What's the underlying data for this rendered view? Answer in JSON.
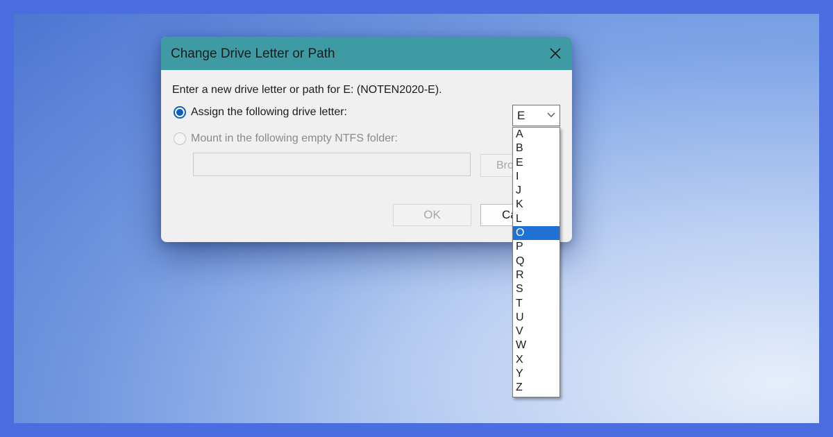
{
  "dialog": {
    "title": "Change Drive Letter or Path",
    "prompt": "Enter a new drive letter or path for E: (NOTEN2020-E).",
    "assign_label": "Assign the following drive letter:",
    "mount_label": "Mount in the following empty NTFS folder:",
    "folder_value": "",
    "browse_label": "Bro",
    "ok_label": "OK",
    "cancel_label": "Ca",
    "titlebar_color": "#3f9ba3"
  },
  "drive_select": {
    "value": "E",
    "options": [
      "A",
      "B",
      "E",
      "I",
      "J",
      "K",
      "L",
      "O",
      "P",
      "Q",
      "R",
      "S",
      "T",
      "U",
      "V",
      "W",
      "X",
      "Y",
      "Z"
    ],
    "highlighted": "O",
    "highlight_color": "#1f72d4"
  }
}
